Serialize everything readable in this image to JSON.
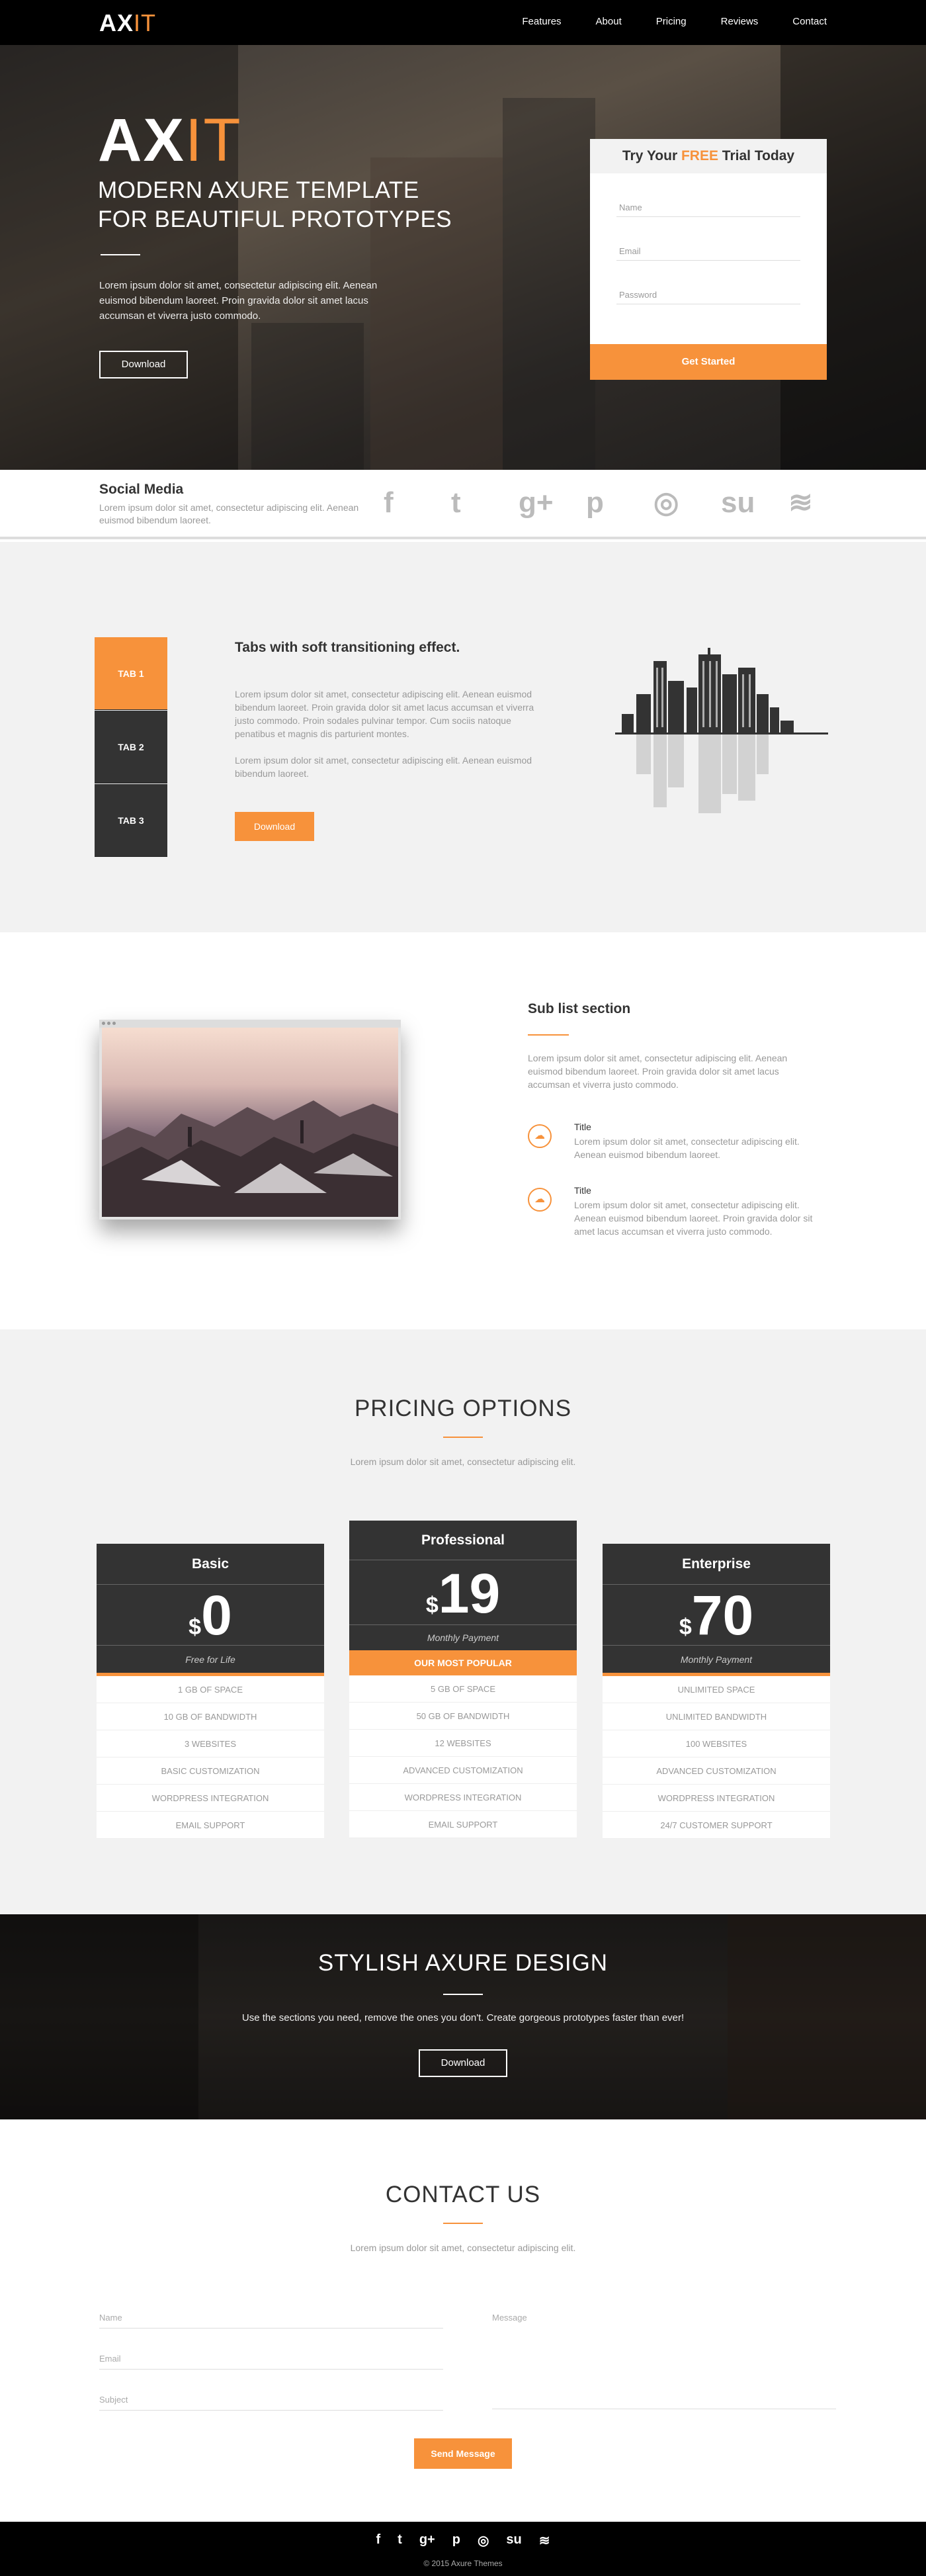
{
  "nav": {
    "logo_a": "AX",
    "logo_b": "IT",
    "links": [
      "Features",
      "About",
      "Pricing",
      "Reviews",
      "Contact"
    ]
  },
  "hero": {
    "logo_a": "AX",
    "logo_b": "IT",
    "tagline_1": "MODERN AXURE TEMPLATE",
    "tagline_2": "FOR BEAUTIFUL PROTOTYPES",
    "lead": "Lorem ipsum dolor sit amet, consectetur adipiscing elit. Aenean euismod bibendum laoreet. Proin gravida dolor sit amet lacus accumsan et viverra justo commodo.",
    "button": "Download"
  },
  "trial_form": {
    "title_pre": "Try Your ",
    "title_free": "FREE",
    "title_post": " Trial Today",
    "name_placeholder": "Name",
    "email_placeholder": "Email",
    "password_placeholder": "Password",
    "submit": "Get Started"
  },
  "social": {
    "title": "Social Media",
    "text": "Lorem ipsum dolor sit amet, consectetur adipiscing elit. Aenean euismod bibendum laoreet.",
    "icons": [
      "f",
      "t",
      "g+",
      "p",
      "◎",
      "su",
      "≋"
    ]
  },
  "tabs": {
    "items": [
      "TAB 1",
      "TAB 2",
      "TAB 3"
    ],
    "heading": "Tabs with soft transitioning effect.",
    "para1": "Lorem ipsum dolor sit amet, consectetur adipiscing elit. Aenean euismod bibendum laoreet. Proin gravida dolor sit amet lacus accumsan et viverra justo commodo. Proin sodales pulvinar tempor. Cum sociis natoque penatibus et magnis dis parturient montes.",
    "para2": "Lorem ipsum dolor sit amet, consectetur adipiscing elit. Aenean euismod bibendum laoreet.",
    "button": "Download"
  },
  "sublist": {
    "heading": "Sub list section",
    "lead": "Lorem ipsum dolor sit amet, consectetur adipiscing elit. Aenean euismod bibendum laoreet. Proin gravida dolor sit amet lacus accumsan et viverra justo commodo.",
    "items": [
      {
        "title": "Title",
        "text": "Lorem ipsum dolor sit amet, consectetur adipiscing elit. Aenean euismod bibendum laoreet."
      },
      {
        "title": "Title",
        "text": "Lorem ipsum dolor sit amet, consectetur adipiscing elit. Aenean euismod bibendum laoreet. Proin gravida dolor sit amet lacus accumsan et viverra justo commodo."
      }
    ]
  },
  "pricing": {
    "title": "PRICING OPTIONS",
    "subtitle": "Lorem ipsum dolor sit amet, consectetur adipiscing elit.",
    "plans": [
      {
        "name": "Basic",
        "currency": "$",
        "price": "0",
        "note": "Free for Life",
        "features": [
          "1 GB OF SPACE",
          "10 GB OF BANDWIDTH",
          "3 WEBSITES",
          "BASIC CUSTOMIZATION",
          "WORDPRESS INTEGRATION",
          "EMAIL SUPPORT"
        ]
      },
      {
        "name": "Professional",
        "currency": "$",
        "price": "19",
        "note": "Monthly Payment",
        "badge": "OUR MOST POPULAR",
        "features": [
          "5 GB OF SPACE",
          "50 GB OF BANDWIDTH",
          "12 WEBSITES",
          "ADVANCED CUSTOMIZATION",
          "WORDPRESS INTEGRATION",
          "EMAIL SUPPORT"
        ]
      },
      {
        "name": "Enterprise",
        "currency": "$",
        "price": "70",
        "note": "Monthly Payment",
        "features": [
          "UNLIMITED SPACE",
          "UNLIMITED BANDWIDTH",
          "100 WEBSITES",
          "ADVANCED CUSTOMIZATION",
          "WORDPRESS INTEGRATION",
          "24/7 CUSTOMER SUPPORT"
        ]
      }
    ]
  },
  "banner": {
    "title": "STYLISH AXURE DESIGN",
    "text": "Use the sections you need, remove the ones you don't.  Create gorgeous prototypes faster than ever!",
    "button": "Download"
  },
  "contact": {
    "title": "CONTACT US",
    "subtitle": "Lorem ipsum dolor sit amet, consectetur adipiscing elit.",
    "name_placeholder": "Name",
    "email_placeholder": "Email",
    "subject_placeholder": "Subject",
    "message_placeholder": "Message",
    "submit": "Send Message"
  },
  "footer": {
    "icons": [
      "f",
      "t",
      "g+",
      "p",
      "◎",
      "su",
      "≋"
    ],
    "copyright": "© 2015 Axure Themes"
  },
  "colors": {
    "accent": "#f7923b",
    "dark": "#333333",
    "nav": "#000000",
    "light_bg": "#f2f2f2"
  }
}
